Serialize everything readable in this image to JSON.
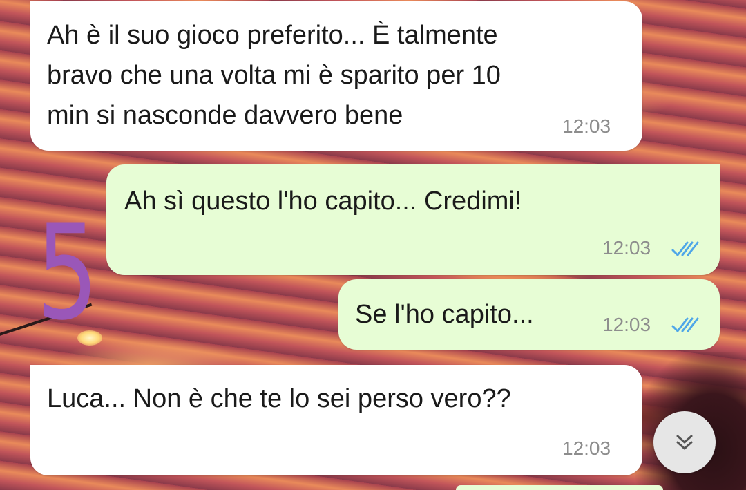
{
  "overlay": {
    "digit": "5"
  },
  "messages": [
    {
      "direction": "incoming",
      "text": "Ah è il suo gioco preferito... È talmente bravo che una volta mi è sparito per 10 min si nasconde davvero bene",
      "lines": [
        "Ah è il suo gioco preferito... È talmente",
        "bravo che una volta mi è sparito per 10",
        "min si nasconde davvero bene"
      ],
      "time": "12:03"
    },
    {
      "direction": "outgoing",
      "text": "Ah sì questo l'ho capito... Credimi!",
      "time": "12:03",
      "status": "read"
    },
    {
      "direction": "outgoing",
      "text": "Se l'ho capito...",
      "time": "12:03",
      "status": "read"
    },
    {
      "direction": "incoming",
      "text": "Luca... Non è che te lo sei perso vero??",
      "time": "12:03"
    }
  ],
  "colors": {
    "incoming": "#ffffff",
    "outgoing": "#e7fdd5",
    "read_ticks": "#4fa6e8",
    "overlay_digit": "#9a57b8"
  },
  "icons": {
    "read_status": "double-check-icon",
    "scroll_down": "chevron-double-down-icon"
  }
}
